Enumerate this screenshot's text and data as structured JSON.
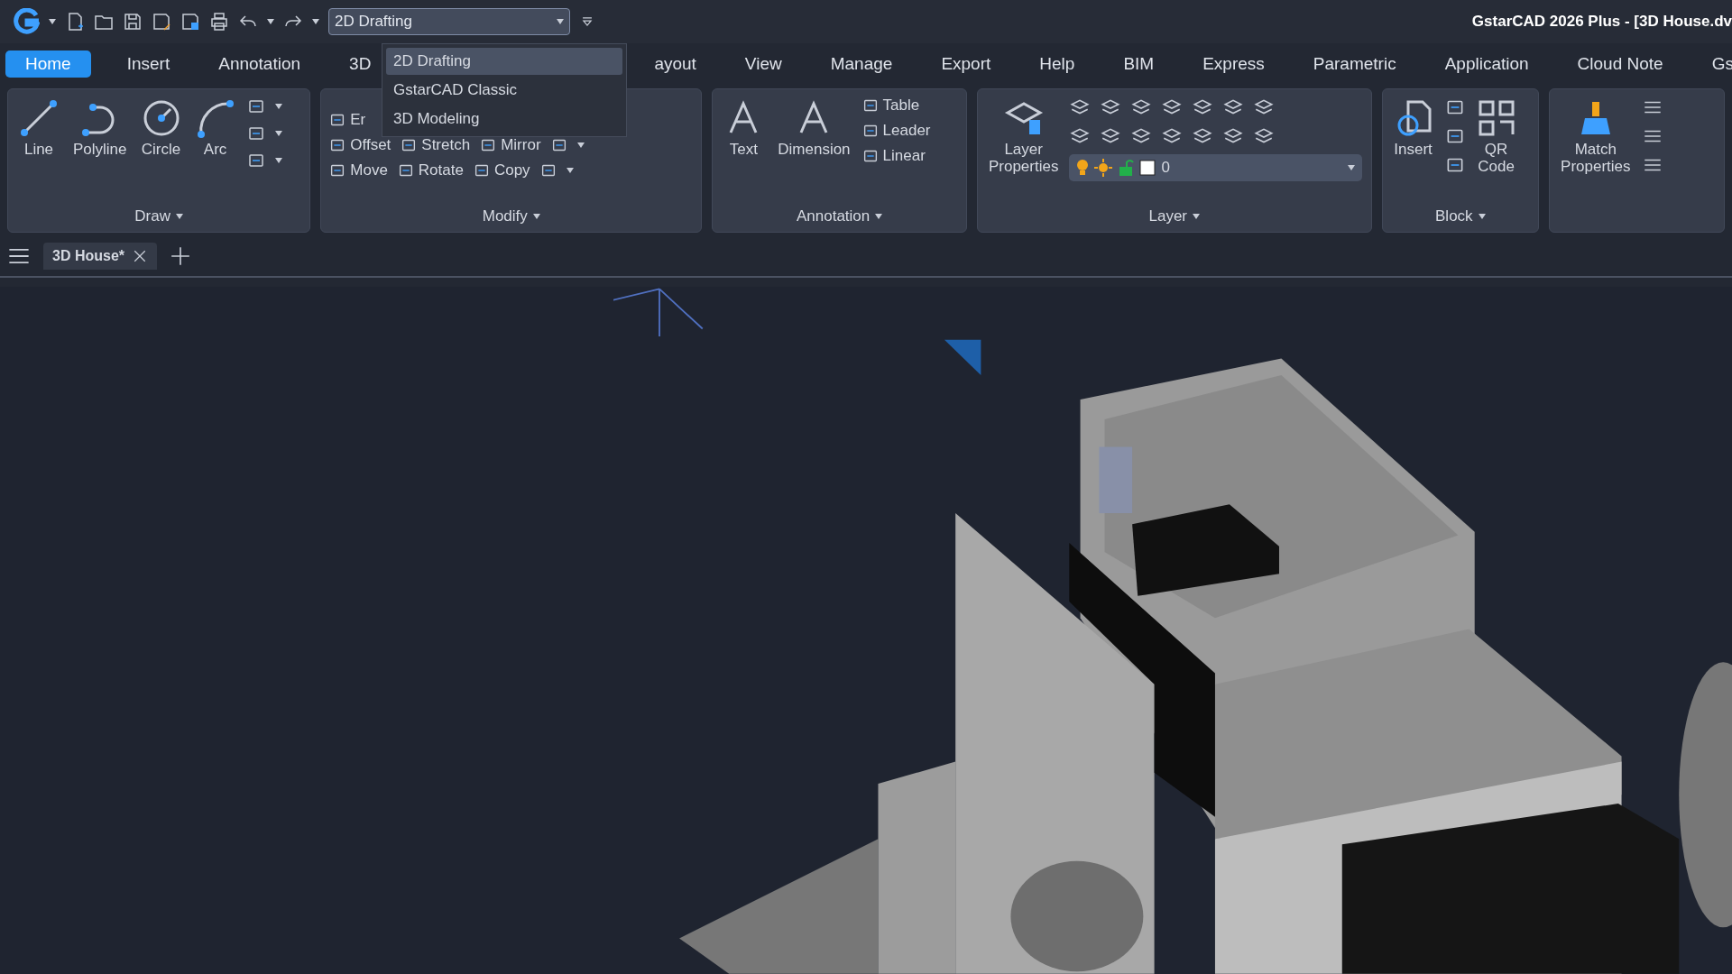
{
  "title_bar": {
    "title": "GstarCAD 2026 Plus - [3D House.dv",
    "workspace": {
      "value": "2D Drafting",
      "expanded": true,
      "options": [
        {
          "label": "2D Drafting",
          "selected": true
        },
        {
          "label": "GstarCAD Classic",
          "selected": false
        },
        {
          "label": "3D Modeling",
          "selected": false
        }
      ]
    }
  },
  "ribbon_tabs": [
    {
      "label": "Home",
      "selected": true
    },
    {
      "label": "Insert",
      "selected": false
    },
    {
      "label": "Annotation",
      "selected": false
    },
    {
      "label": "3D",
      "selected": false
    },
    {
      "label": "ayout",
      "selected": false
    },
    {
      "label": "View",
      "selected": false
    },
    {
      "label": "Manage",
      "selected": false
    },
    {
      "label": "Export",
      "selected": false
    },
    {
      "label": "Help",
      "selected": false
    },
    {
      "label": "BIM",
      "selected": false
    },
    {
      "label": "Express",
      "selected": false
    },
    {
      "label": "Parametric",
      "selected": false
    },
    {
      "label": "Application",
      "selected": false
    },
    {
      "label": "Cloud Note",
      "selected": false
    },
    {
      "label": "Gs",
      "selected": false
    }
  ],
  "panels": {
    "draw": {
      "label": "Draw",
      "tools": [
        "Line",
        "Polyline",
        "Circle",
        "Arc"
      ]
    },
    "modify": {
      "label": "Modify",
      "rows": [
        [
          "Er"
        ],
        [
          "Offset",
          "Stretch",
          "Mirror"
        ],
        [
          "Move",
          "Rotate",
          "Copy"
        ]
      ]
    },
    "annotation": {
      "label": "Annotation",
      "tools": [
        "Text",
        "Dimension"
      ],
      "small_tools": [
        "Table",
        "Leader",
        "Linear"
      ]
    },
    "layer": {
      "label": "Layer",
      "tool": "Layer Properties",
      "current_layer": "0"
    },
    "block": {
      "label": "Block",
      "tools": [
        "Insert"
      ],
      "qr": "QR Code"
    },
    "match": {
      "tool": "Match Properties"
    }
  },
  "document_tabs": [
    {
      "label": "3D House*",
      "selected": true
    }
  ]
}
